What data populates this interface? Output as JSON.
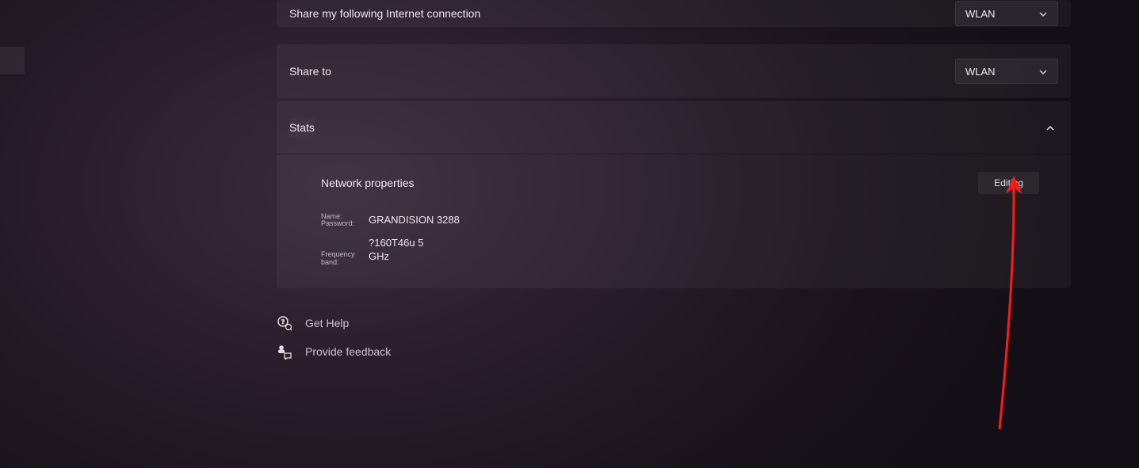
{
  "rows": {
    "share_source": {
      "label": "Share my following Internet connection",
      "value": "WLAN"
    },
    "share_to": {
      "label": "Share to",
      "value": "WLAN"
    }
  },
  "stats": {
    "title": "Stats",
    "network_properties_title": "Network properties",
    "edit_button": "Editing",
    "labels": {
      "name": "Name:",
      "password": "Password:",
      "freq": "Frequency band:"
    },
    "values": {
      "name": "GRANDISION 3288",
      "password": "?160T46u 5",
      "freq": "GHz"
    }
  },
  "footer": {
    "help": "Get Help",
    "feedback": "Provide feedback"
  }
}
